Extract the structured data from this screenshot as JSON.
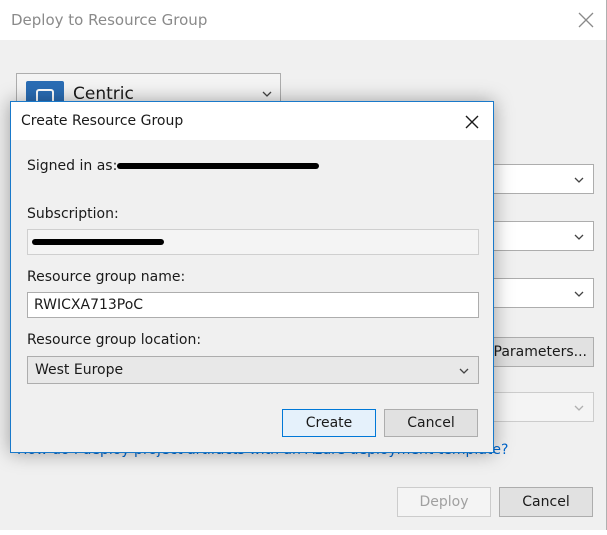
{
  "background_window": {
    "title": "Deploy to Resource Group",
    "account_name": "Centric",
    "edit_parameters_label": "it Parameters...",
    "help_link": "How do I deploy project artifacts with an Azure deployment template?",
    "deploy_label": "Deploy",
    "cancel_label": "Cancel"
  },
  "dialog": {
    "title": "Create Resource Group",
    "signed_in_label": "Signed in as:",
    "subscription_label": "Subscription:",
    "subscription_value": "",
    "resource_group_name_label": "Resource group name:",
    "resource_group_name_value": "RWICXA713PoC",
    "resource_group_location_label": "Resource group location:",
    "resource_group_location_value": "West Europe",
    "create_label": "Create",
    "cancel_label": "Cancel"
  },
  "colors": {
    "accent": "#0078d7",
    "dialog_border": "#1979ca",
    "link": "#0066cc",
    "logo": "#2a6db5"
  },
  "icons": {
    "close": "close-icon",
    "dropdown": "chevron-down-icon",
    "account_logo": "account-logo-icon"
  }
}
